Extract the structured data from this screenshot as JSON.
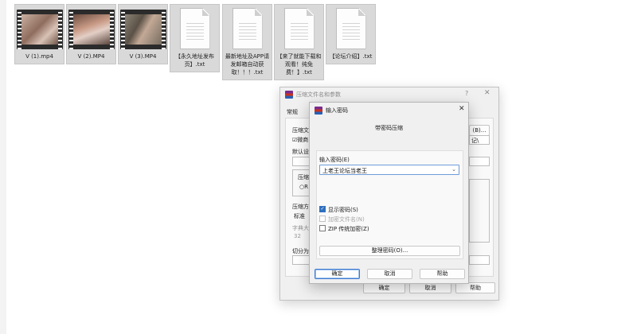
{
  "explorer": {
    "files": [
      {
        "name": "V (1).mp4",
        "type": "video"
      },
      {
        "name": "V (2).MP4",
        "type": "video"
      },
      {
        "name": "V (3).MP4",
        "type": "video"
      },
      {
        "name": "【永久地址发布页】.txt",
        "type": "text"
      },
      {
        "name": "最新地址及APP请发邮箱自动获取！！！.txt",
        "type": "text"
      },
      {
        "name": "【来了就能下载和观看！纯免费！】.txt",
        "type": "text"
      },
      {
        "name": "【论坛介绍】.txt",
        "type": "text"
      }
    ]
  },
  "archive_dialog": {
    "title": "压缩文件名和参数",
    "help_glyph": "?",
    "close_glyph": "✕",
    "tab_general": "常规",
    "archive_name_label": "压缩文",
    "browse_btn": "(B)...",
    "update_fragment": "☑微商",
    "mode_fragment": "记\\",
    "default_label": "默认设",
    "format_label": "压缩",
    "format_radio": "○R",
    "method_label": "压缩方",
    "method_value": "标准",
    "dict_label": "字典大",
    "dict_value": "32",
    "split_label": "切分为",
    "ok": "确定",
    "cancel": "取消",
    "help": "帮助"
  },
  "password_dialog": {
    "title": "输入密码",
    "close_glyph": "✕",
    "subtitle": "带密码压缩",
    "password_label": "输入密码(E)",
    "password_value": "上老王论坛当老王",
    "dropdown_glyph": "⌄",
    "options": [
      {
        "label": "显示密码(S)",
        "checked": true,
        "enabled": true
      },
      {
        "label": "加密文件名(N)",
        "checked": false,
        "enabled": false
      },
      {
        "label": "ZIP 传统加密(Z)",
        "checked": false,
        "enabled": true
      }
    ],
    "organize_btn": "整理密码(O)...",
    "ok": "确定",
    "cancel": "取消",
    "help": "帮助"
  }
}
